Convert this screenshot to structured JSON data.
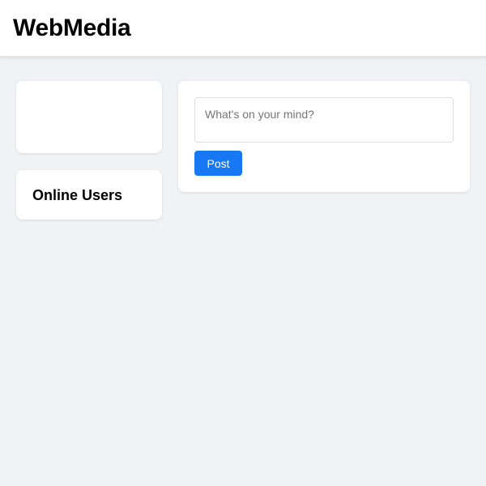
{
  "header": {
    "title": "WebMedia"
  },
  "sidebar": {
    "online_users": {
      "title": "Online Users"
    }
  },
  "composer": {
    "placeholder": "What's on your mind?",
    "value": "",
    "post_label": "Post"
  },
  "colors": {
    "background": "#f0f2f5",
    "card": "#ffffff",
    "accent": "#1877f2"
  }
}
